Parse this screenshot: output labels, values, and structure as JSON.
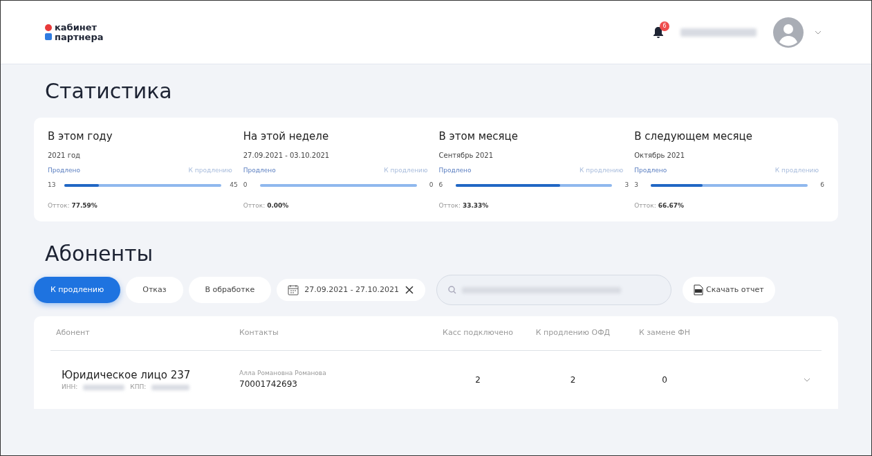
{
  "header": {
    "logo": [
      "кабинет",
      "партнера"
    ],
    "notification_count": "6"
  },
  "statistics": {
    "title": "Статистика",
    "cards": [
      {
        "title": "В этом году",
        "period": "2021 год",
        "renewed_label": "Продлено",
        "pending_label": "К продлению",
        "renewed": "13",
        "pending": "45",
        "level": 0.22,
        "churn_label": "Отток:",
        "churn": "77.59%"
      },
      {
        "title": "На этой неделе",
        "period": "27.09.2021 - 03.10.2021",
        "renewed_label": "Продлено",
        "pending_label": "К продлению",
        "renewed": "0",
        "pending": "0",
        "level": 0,
        "churn_label": "Отток:",
        "churn": "0.00%"
      },
      {
        "title": "В этом месяце",
        "period": "Сентябрь 2021",
        "renewed_label": "Продлено",
        "pending_label": "К продлению",
        "renewed": "6",
        "pending": "3",
        "level": 0.67,
        "churn_label": "Отток:",
        "churn": "33.33%"
      },
      {
        "title": "В следующем месяце",
        "period": "Октябрь 2021",
        "renewed_label": "Продлено",
        "pending_label": "К продлению",
        "renewed": "3",
        "pending": "6",
        "level": 0.33,
        "churn_label": "Отток:",
        "churn": "66.67%"
      }
    ]
  },
  "subscribers": {
    "title": "Абоненты",
    "filters": [
      {
        "label": "К продлению",
        "selected": true
      },
      {
        "label": "Отказ",
        "selected": false
      },
      {
        "label": "В обработке",
        "selected": false
      }
    ],
    "date_range": "27.09.2021 - 27.10.2021",
    "download_button": "Скачать отчет",
    "table": {
      "columns": [
        "Абонент",
        "Контакты",
        "Касс подключено",
        "К продлению ОФД",
        "К замене ФН"
      ],
      "rows": [
        {
          "name": "Юридическое лицо 237",
          "inn_label": "ИНН:",
          "kpp_label": "КПП:",
          "contact_name": "Алла Романовна Романова",
          "phone": "70001742693",
          "cash_registers": "2",
          "ofd_renewal": "2",
          "fn_replacement": "0"
        }
      ]
    }
  }
}
